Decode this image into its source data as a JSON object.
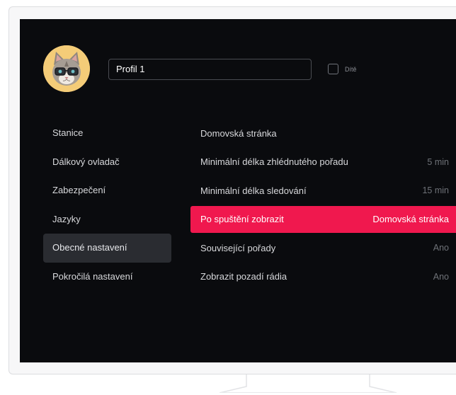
{
  "profile": {
    "name_value": "Profil 1",
    "child_label": "Dítě",
    "child_checked": false,
    "avatar_icon": "cat-with-glasses-avatar"
  },
  "menu": {
    "items": [
      {
        "label": "Stanice",
        "active": false
      },
      {
        "label": "Dálkový ovladač",
        "active": false
      },
      {
        "label": "Zabezpečení",
        "active": false
      },
      {
        "label": "Jazyky",
        "active": false
      },
      {
        "label": "Obecné nastavení",
        "active": true
      },
      {
        "label": "Pokročilá nastavení",
        "active": false
      }
    ]
  },
  "settings": {
    "rows": [
      {
        "label": "Domovská stránka",
        "value": ""
      },
      {
        "label": "Minimální délka zhlédnutého pořadu",
        "value": "5 min"
      },
      {
        "label": "Minimální délka sledování",
        "value": "15 min"
      },
      {
        "label": "Po spuštění zobrazit",
        "value": "Domovská stránka",
        "highlight": true
      },
      {
        "label": "Související pořady",
        "value": "Ano"
      },
      {
        "label": "Zobrazit pozadí rádia",
        "value": "Ano"
      }
    ]
  },
  "colors": {
    "screen_bg": "#0a0b0e",
    "accent": "#f0184e",
    "active_menu_bg": "#2a2c31",
    "avatar_bg": "#f4cc78"
  }
}
